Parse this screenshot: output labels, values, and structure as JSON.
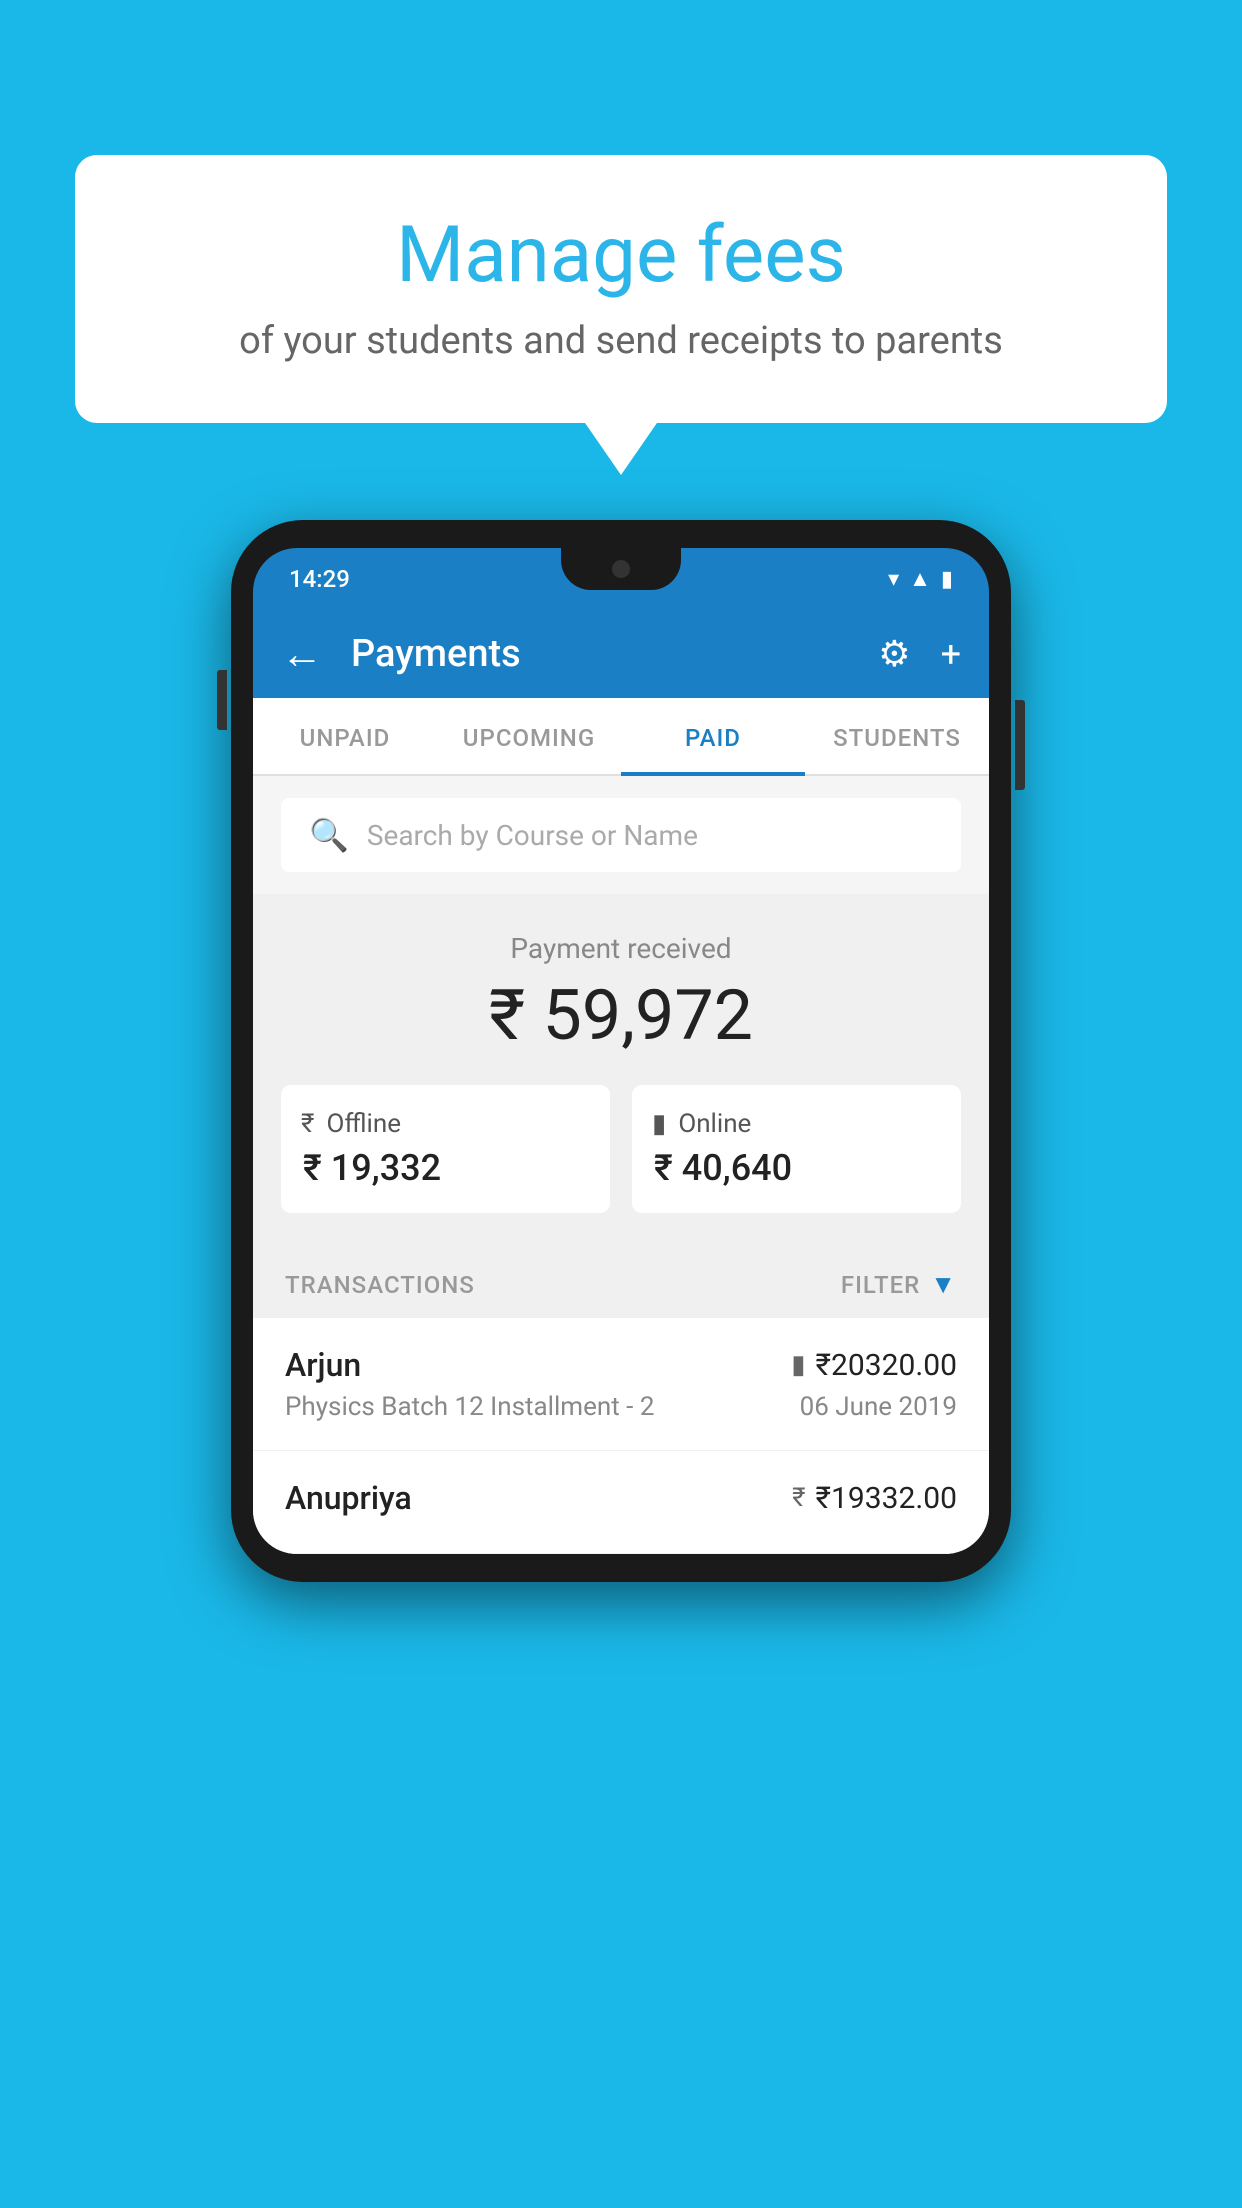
{
  "background_color": "#1ab8e8",
  "bubble": {
    "title": "Manage fees",
    "subtitle": "of your students and send receipts to parents"
  },
  "phone": {
    "status_bar": {
      "time": "14:29"
    },
    "app_bar": {
      "title": "Payments",
      "back_label": "←",
      "settings_label": "⚙",
      "add_label": "+"
    },
    "tabs": [
      {
        "label": "UNPAID",
        "active": false
      },
      {
        "label": "UPCOMING",
        "active": false
      },
      {
        "label": "PAID",
        "active": true
      },
      {
        "label": "STUDENTS",
        "active": false
      }
    ],
    "search": {
      "placeholder": "Search by Course or Name"
    },
    "payment_summary": {
      "label": "Payment received",
      "amount": "₹ 59,972",
      "offline": {
        "type": "Offline",
        "amount": "₹ 19,332"
      },
      "online": {
        "type": "Online",
        "amount": "₹ 40,640"
      }
    },
    "transactions": {
      "header_label": "TRANSACTIONS",
      "filter_label": "FILTER",
      "items": [
        {
          "name": "Arjun",
          "amount": "₹20320.00",
          "course": "Physics Batch 12 Installment - 2",
          "date": "06 June 2019",
          "mode": "card"
        },
        {
          "name": "Anupriya",
          "amount": "₹19332.00",
          "course": "",
          "date": "",
          "mode": "cash"
        }
      ]
    }
  }
}
